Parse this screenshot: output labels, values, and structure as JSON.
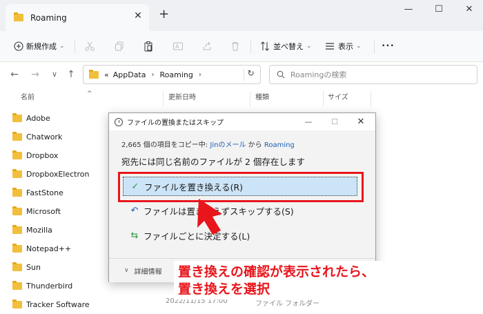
{
  "window": {
    "tab_title": "Roaming",
    "tab_close": "✕",
    "new_tab": "+",
    "minimize": "—",
    "maximize": "☐",
    "close": "✕"
  },
  "toolbar": {
    "new_label": "新規作成",
    "sort_label": "並べ替え",
    "view_label": "表示",
    "more": "•••"
  },
  "navigation": {
    "back": "←",
    "forward": "→",
    "down": "∨",
    "up": "↑",
    "address_prefix": "«",
    "path": [
      "AppData",
      "Roaming"
    ],
    "search_placeholder": "Roamingの検索"
  },
  "columns": {
    "name": "名前",
    "date": "更新日時",
    "type": "種類",
    "size": "サイズ"
  },
  "files": [
    {
      "name": "Adobe"
    },
    {
      "name": "Chatwork"
    },
    {
      "name": "Dropbox"
    },
    {
      "name": "DropboxElectron"
    },
    {
      "name": "FastStone"
    },
    {
      "name": "Microsoft"
    },
    {
      "name": "Mozilla"
    },
    {
      "name": "Notepad++"
    },
    {
      "name": "Sun"
    },
    {
      "name": "Thunderbird"
    },
    {
      "name": "Tracker Software"
    }
  ],
  "last_row_partial": {
    "date": "2022/11/15 17:00",
    "type": "ファイル フォルダー"
  },
  "dialog": {
    "title": "ファイルの置換またはスキップ",
    "info_count": "2,665 個の項目をコピー中:",
    "info_source": "Jinのメール",
    "info_from": "から",
    "info_dest": "Roaming",
    "heading": "宛先には同じ名前のファイルが 2 個存在します",
    "options": [
      {
        "label": "ファイルを置き換える(R)",
        "icon": "✓"
      },
      {
        "label": "ファイルは置き換えずスキップする(S)",
        "icon": "↶"
      },
      {
        "label": "ファイルごとに決定する(L)",
        "icon": "⇆"
      }
    ],
    "details": "詳細情報"
  },
  "callout": {
    "line1": "置き換えの確認が表示されたら、",
    "line2": "置き換えを選択"
  },
  "colors": {
    "accent_red": "#e8151b",
    "selection_blue": "#cce4f7",
    "link_blue": "#1a5fb4",
    "folder_yellow": "#f2bf3d"
  }
}
